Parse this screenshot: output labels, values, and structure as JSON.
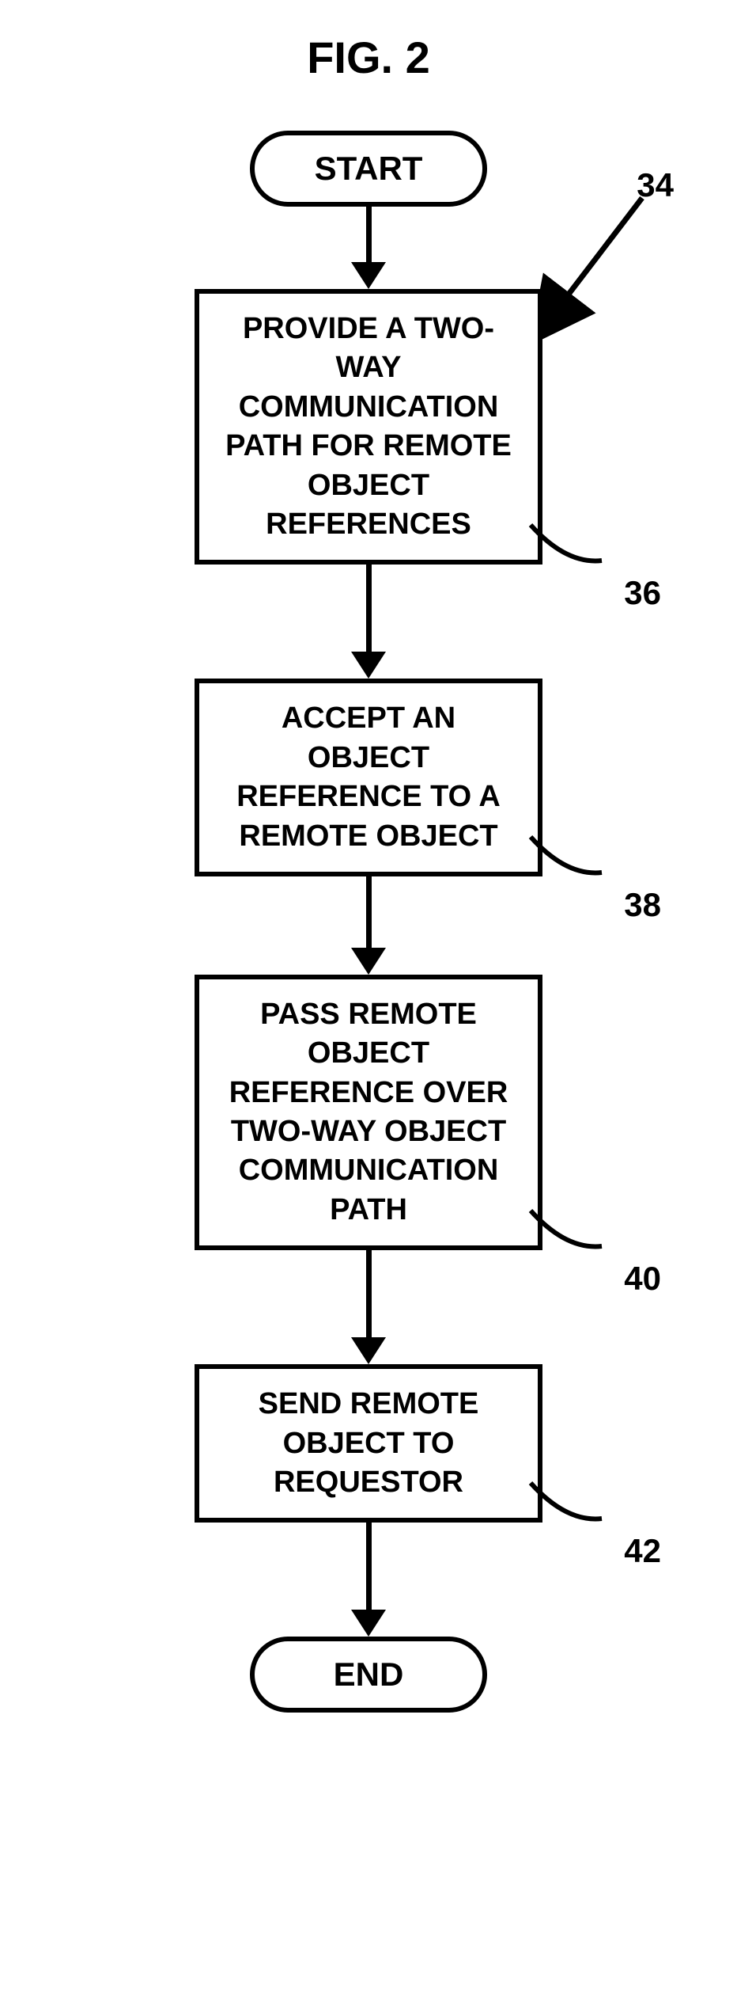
{
  "title": "FIG. 2",
  "nodes": {
    "start": "START",
    "step1": "PROVIDE A TWO-WAY COMMUNICATION PATH FOR REMOTE OBJECT REFERENCES",
    "step2": "ACCEPT AN OBJECT REFERENCE TO A REMOTE OBJECT",
    "step3": "PASS REMOTE OBJECT REFERENCE OVER TWO-WAY OBJECT COMMUNICATION PATH",
    "step4": "SEND REMOTE OBJECT TO REQUESTOR",
    "end": "END"
  },
  "refs": {
    "overall": "34",
    "step1": "36",
    "step2": "38",
    "step3": "40",
    "step4": "42"
  }
}
